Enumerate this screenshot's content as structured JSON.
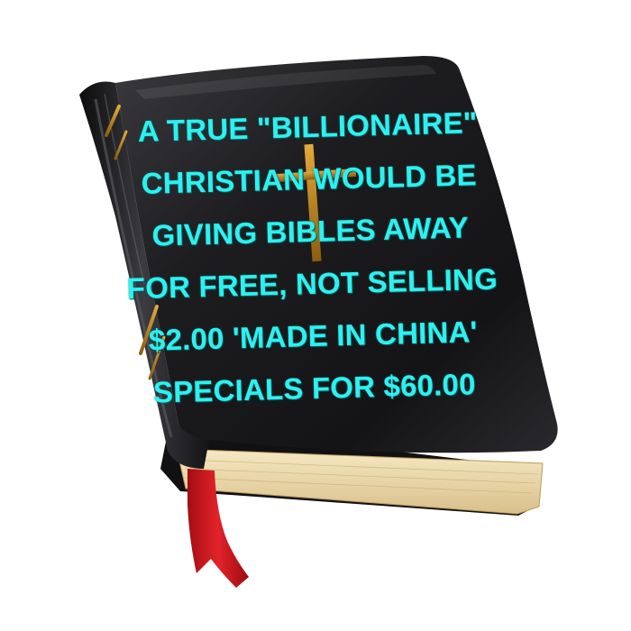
{
  "caption": {
    "lines": [
      "A TRUE \"BILLIONAIRE\"",
      "CHRISTIAN WOULD BE",
      "GIVING BIBLES AWAY",
      "FOR FREE, NOT SELLING",
      "$2.00 'MADE IN CHINA'",
      "SPECIALS FOR $60.00"
    ],
    "color": "#2ff0ee"
  },
  "book": {
    "cover_color": "#1c1c1e",
    "page_color": "#efe0b4",
    "accent_color": "#c8901c",
    "ribbon_color": "#d9141b",
    "icons": [
      "cross-icon",
      "bookmark-ribbon"
    ]
  }
}
